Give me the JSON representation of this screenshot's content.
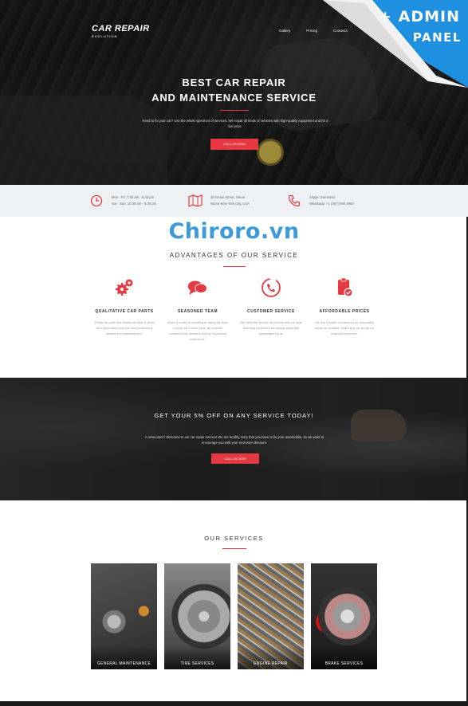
{
  "header": {
    "logo": "CAR REPAIR",
    "logo_tagline": "EVOLUTION",
    "nav": [
      "Gallery",
      "Pricing",
      "Contacts"
    ]
  },
  "hero": {
    "title_line1": "BEST CAR REPAIR",
    "title_line2": "AND MAINTENANCE SERVICE",
    "text": "Need to fix your car? Use the whole spectrum of services. We repair all kinds of vehicles with high-quality equipment and for a fair price.",
    "button": "CALL US NOW"
  },
  "ribbon": {
    "line1": "+ ADMIN",
    "line2": "PANEL"
  },
  "info": {
    "hours": {
      "line1": "Mon - Fri: 7:30 am - 6:30 pm",
      "line2": "Sat - Sun: 10:30 am - 5:30 pm"
    },
    "address": {
      "line1": "30 Grove Street, Street",
      "line2": "Name New York City, USA"
    },
    "phone": {
      "line1": "Skype: Someoscl",
      "line2": "Whatsapp: +1 (467) 890 4950"
    }
  },
  "watermark": "Chiroro.vn",
  "advantages": {
    "title": "ADVANTAGES OF OUR SERVICE",
    "items": [
      {
        "title": "QUALITATIVE CAR PARTS",
        "text": "All the car parts and details we have in stock were purchased from the most trustworthy dealers and manufacturers."
      },
      {
        "title": "SEASONED TEAM",
        "text": "When it comes to repairing or taking the hook on your car's small parts, all our team combined has almost a century of practical experience."
      },
      {
        "title": "CUSTOMER SERVICE",
        "text": "We value the service we provide and our loyal returning customers are always especially appreciated by us."
      },
      {
        "title": "AFFORDABLE PRICES",
        "text": "We aim to make our services as reasonably priced as possible. That's why we set all our business expenses."
      }
    ]
  },
  "promo": {
    "title": "GET YOUR 5% OFF ON ANY SERVICE TODAY!",
    "text": "A newcomer? Welcome to our car repair service! We are terribly sorry that you have to fix your automobile, so we want to encourage you with your exclusive discount.",
    "button": "CALL US NOW"
  },
  "services": {
    "title": "OUR SERVICES",
    "items": [
      "GENERAL MAINTENANCE",
      "TIRE SERVICES",
      "ENGINE REPAIR",
      "BRAKE SERVICES"
    ]
  },
  "colors": {
    "accent": "#e53840",
    "ribbon": "#1f8fe0",
    "watermark": "#3b9ad9"
  }
}
